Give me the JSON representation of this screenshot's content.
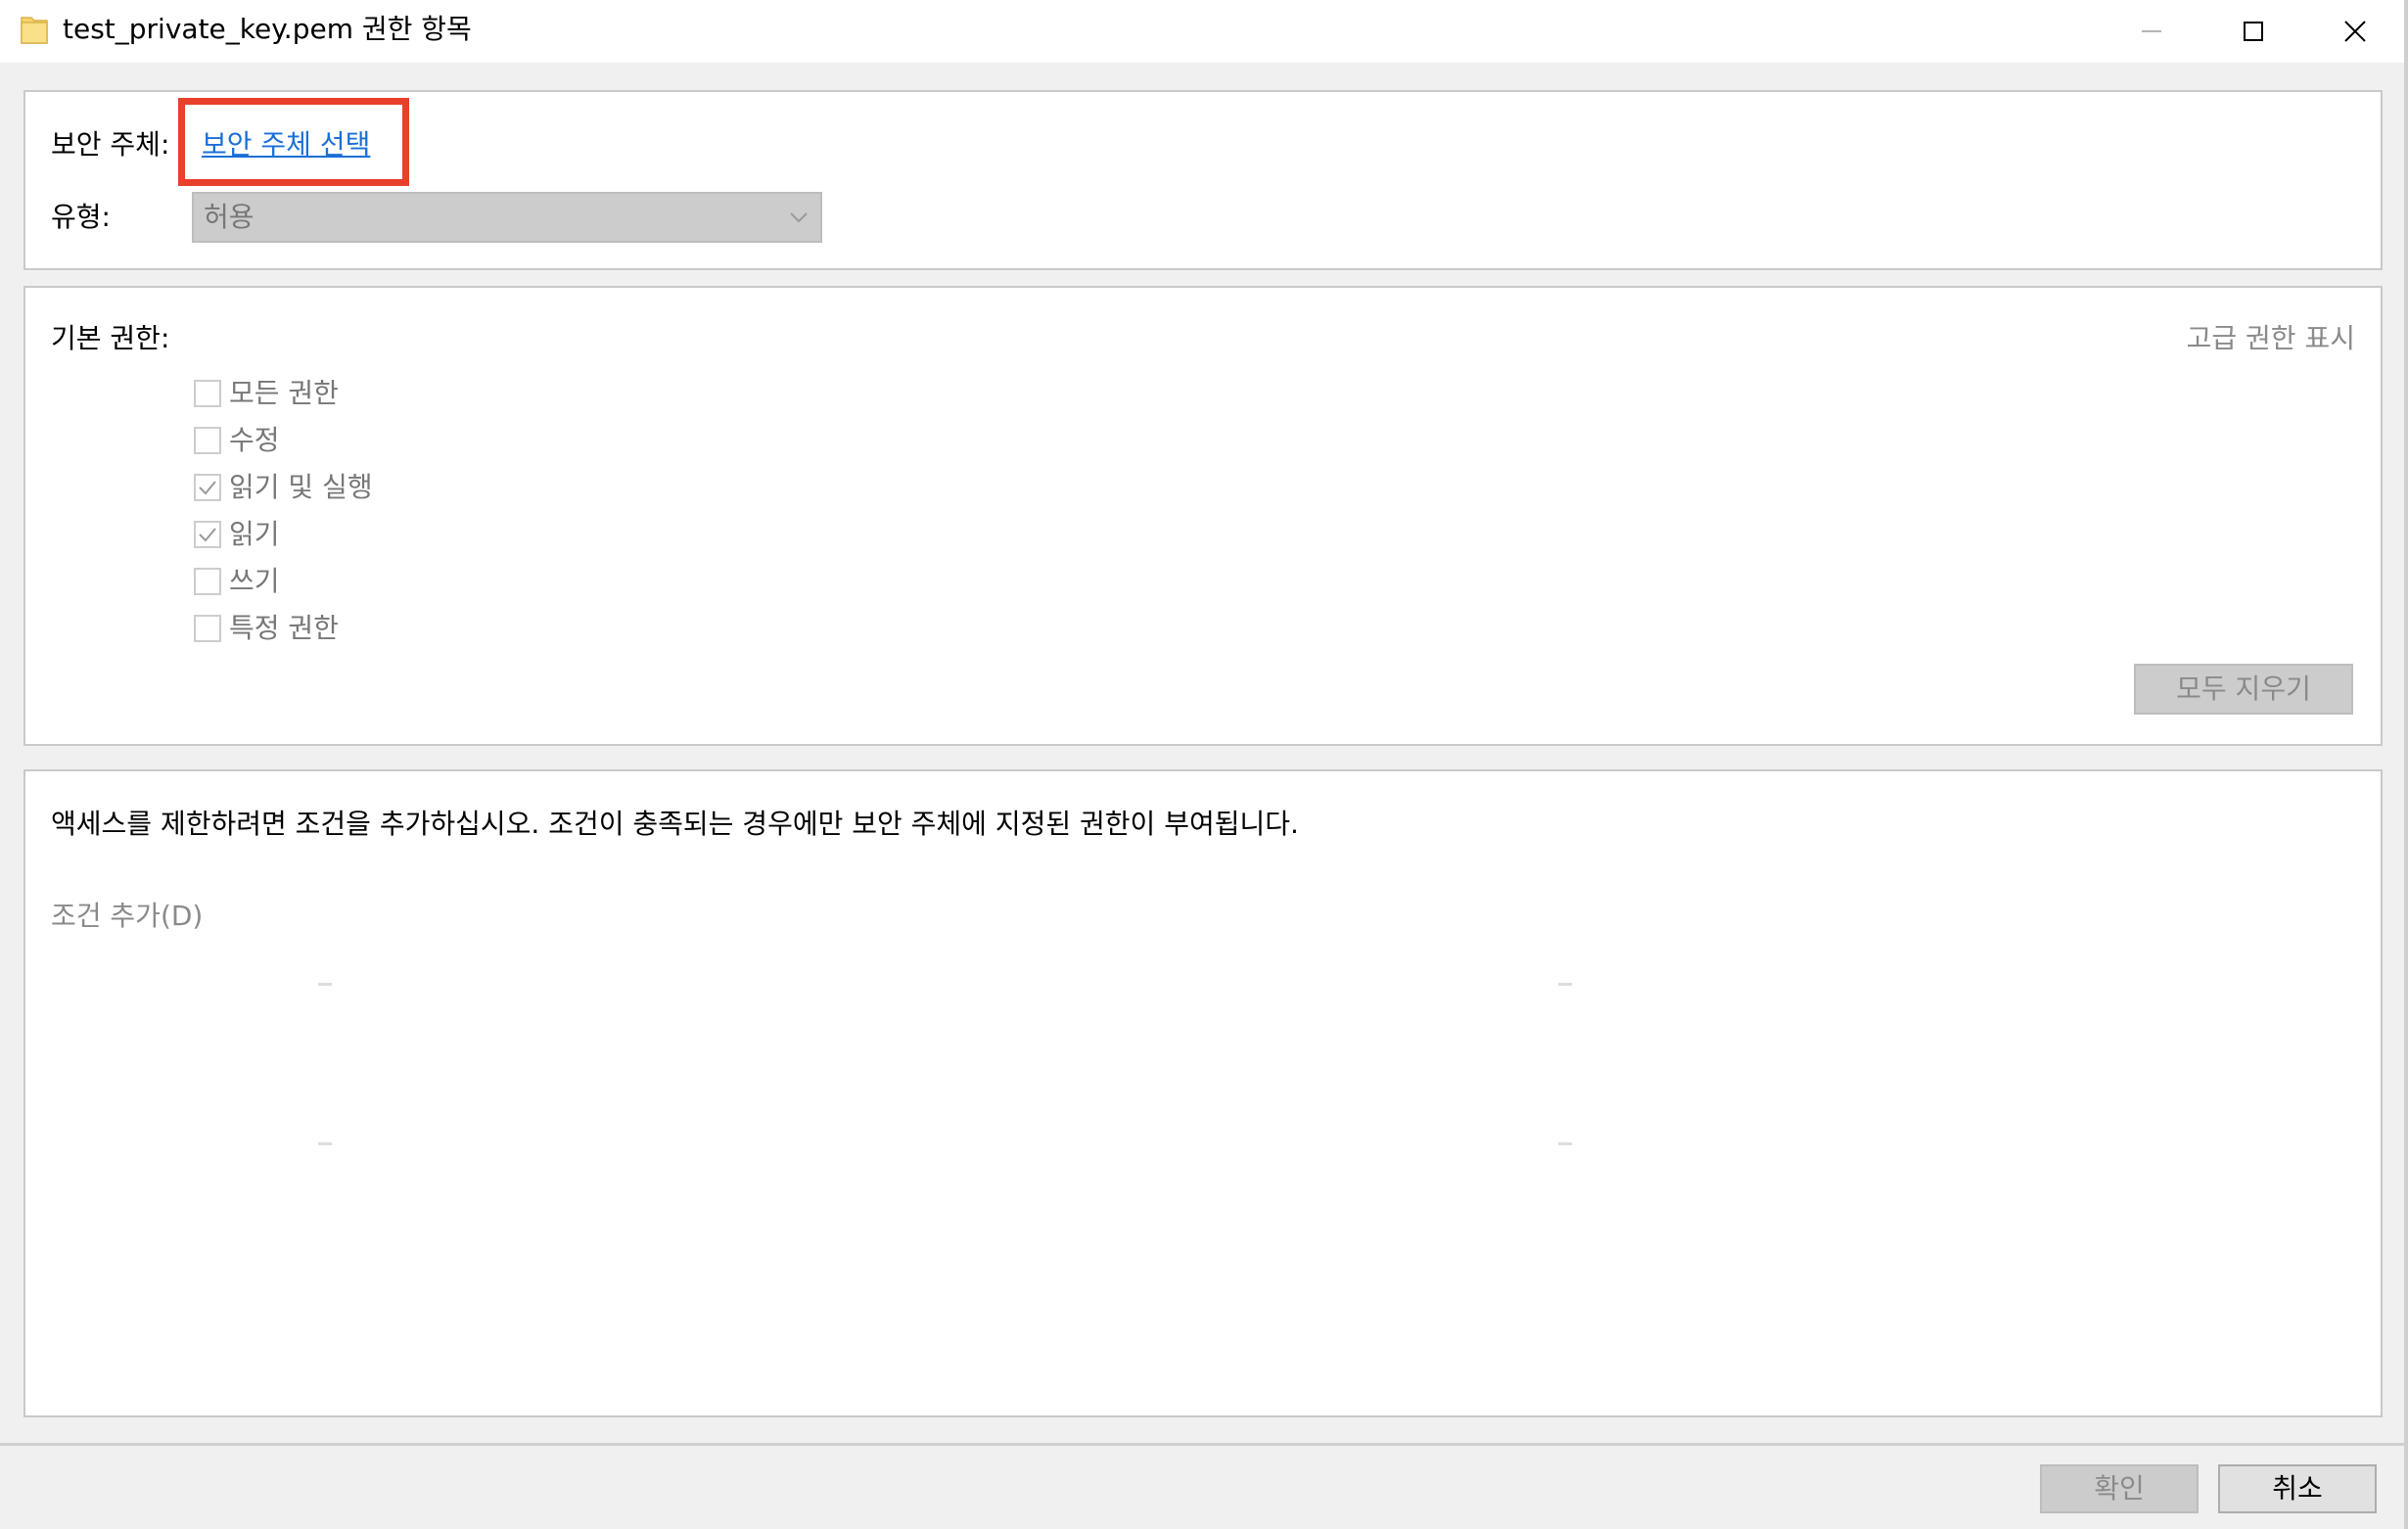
{
  "window": {
    "title": "test_private_key.pem 권한 항목",
    "icon": "folder-icon"
  },
  "principal": {
    "label": "보안 주체:",
    "link": "보안 주체 선택",
    "type_label": "유형:",
    "type_value": "허용"
  },
  "permissions": {
    "label": "기본 권한:",
    "advanced_link": "고급 권한 표시",
    "items": [
      {
        "label": "모든 권한",
        "checked": false
      },
      {
        "label": "수정",
        "checked": false
      },
      {
        "label": "읽기 및 실행",
        "checked": true
      },
      {
        "label": "읽기",
        "checked": true
      },
      {
        "label": "쓰기",
        "checked": false
      },
      {
        "label": "특정 권한",
        "checked": false
      }
    ],
    "clear_button": "모두 지우기"
  },
  "conditions": {
    "text": "액세스를 제한하려면 조건을 추가하십시오. 조건이 충족되는 경우에만 보안 주체에 지정된 권한이 부여됩니다.",
    "add_link": "조건 추가(D)"
  },
  "footer": {
    "ok": "확인",
    "cancel": "취소"
  },
  "colors": {
    "link": "#1b6fd6",
    "highlight": "#e8402b",
    "disabled_text": "#8a8a8a"
  }
}
